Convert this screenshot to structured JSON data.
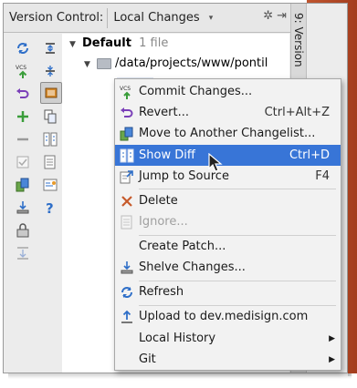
{
  "titlebar": {
    "label": "Version Control:",
    "dropdown_value": "Local Changes",
    "dropdown_arrow": "▾"
  },
  "vertical_tab": {
    "label": "9: Version"
  },
  "tree": {
    "root_label": "Default",
    "root_count": "1 file",
    "folder_path": "/data/projects/www/pontil"
  },
  "menu": {
    "items": [
      {
        "label": "Commit Changes...",
        "shortcut": "",
        "icon": "vcs-commit-icon"
      },
      {
        "label": "Revert...",
        "shortcut": "Ctrl+Alt+Z",
        "icon": "revert-icon"
      },
      {
        "label": "Move to Another Changelist...",
        "shortcut": "",
        "icon": "move-changelist-icon"
      },
      {
        "label": "Show Diff",
        "shortcut": "Ctrl+D",
        "icon": "diff-icon"
      },
      {
        "label": "Jump to Source",
        "shortcut": "F4",
        "icon": "jump-to-source-icon"
      },
      {
        "label": "Delete",
        "shortcut": "",
        "icon": "delete-icon"
      },
      {
        "label": "Ignore...",
        "shortcut": "",
        "icon": "ignore-icon"
      },
      {
        "label": "Create Patch...",
        "shortcut": "",
        "icon": ""
      },
      {
        "label": "Shelve Changes...",
        "shortcut": "",
        "icon": "shelve-icon"
      },
      {
        "label": "Refresh",
        "shortcut": "",
        "icon": "refresh-icon"
      },
      {
        "label": "Upload to dev.medisign.com",
        "shortcut": "",
        "icon": "upload-icon"
      },
      {
        "label": "Local History",
        "shortcut": "",
        "icon": ""
      },
      {
        "label": "Git",
        "shortcut": "",
        "icon": ""
      }
    ],
    "selected_index": 3,
    "disabled_index": 6
  },
  "colors": {
    "selection": "#3875d7",
    "accent_orange": "#b8492a"
  }
}
